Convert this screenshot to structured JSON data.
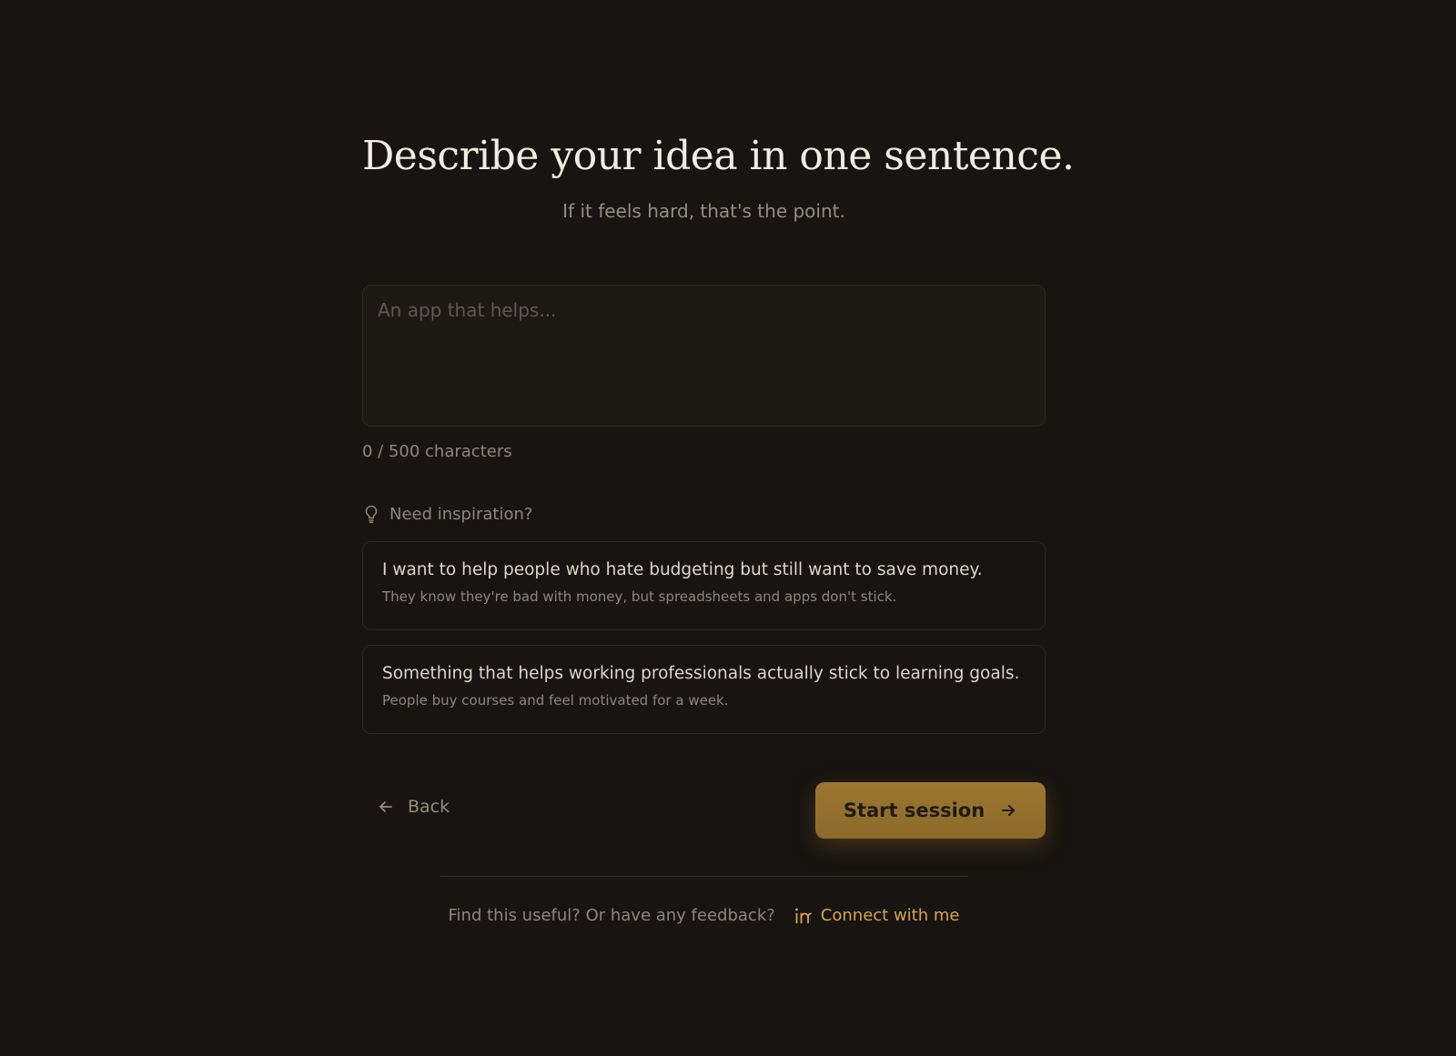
{
  "header": {
    "title": "Describe your idea in one sentence.",
    "subtitle": "If it feels hard, that's the point."
  },
  "idea_input": {
    "value": "",
    "placeholder": "An app that helps...",
    "counter": "0 / 500 characters"
  },
  "inspiration": {
    "label": "Need inspiration?",
    "icon": "lightbulb-icon",
    "suggestions": [
      {
        "title": "I want to help people who hate budgeting but still want to save money.",
        "subtitle": "They know they're bad with money, but spreadsheets and apps don't stick."
      },
      {
        "title": "Something that helps working professionals actually stick to learning goals.",
        "subtitle": "People buy courses and feel motivated for a week."
      }
    ]
  },
  "actions": {
    "back_label": "Back",
    "back_icon": "arrow-left-icon",
    "start_label": "Start session",
    "start_icon": "arrow-right-icon"
  },
  "footer": {
    "prompt": "Find this useful? Or have any feedback?",
    "link_label": "Connect with me",
    "link_icon": "linkedin-icon"
  },
  "colors": {
    "background": "#171411",
    "accent": "#9c7631",
    "link": "#d9a54a"
  }
}
